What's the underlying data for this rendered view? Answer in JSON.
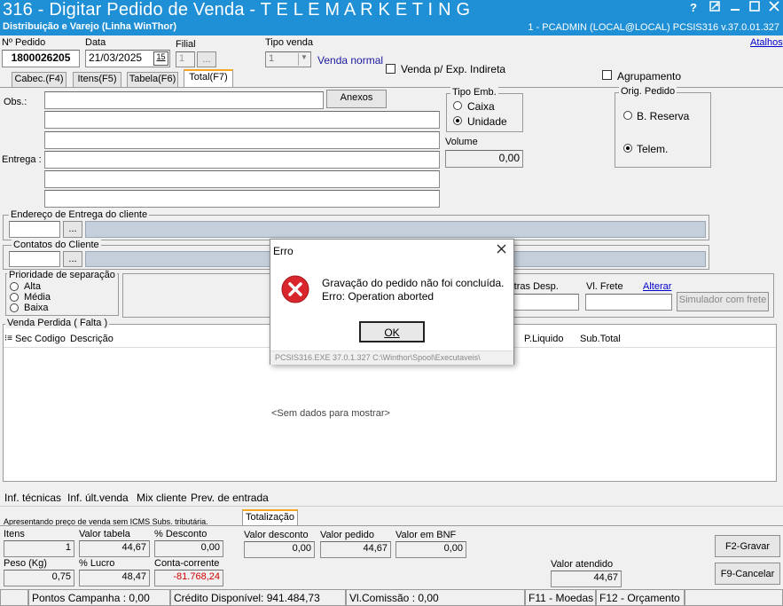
{
  "window": {
    "title": "316 - Digitar Pedido de Venda - T E L E M A R K E T I N G",
    "subtitle": "Distribuição e Varejo (Linha WinThor)",
    "session": "1 - PCADMIN (LOCAL@LOCAL)   PCSIS316  v.37.0.01.327",
    "help_glyph": "?",
    "atalhos": "Atalhos"
  },
  "header": {
    "pedido_label": "Nº Pedido",
    "pedido_value": "1800026205",
    "data_label": "Data",
    "data_value": "21/03/2025",
    "calendar_glyph": "15",
    "filial_label": "Filial",
    "filial_value": "1",
    "filial_btn": "...",
    "tipo_venda_label": "Tipo venda",
    "tipo_venda_value": "1",
    "tipo_venda_desc": "Venda normal",
    "exp_indireta_label": "Venda p/ Exp. Indireta",
    "agrupamento_label": "Agrupamento"
  },
  "tabs": [
    {
      "label": "Cabec.(F4)"
    },
    {
      "label": "Itens(F5)"
    },
    {
      "label": "Tabela(F6)"
    },
    {
      "label": "Total(F7)"
    }
  ],
  "total": {
    "obs_label": "Obs.:",
    "anexos_btn": "Anexos",
    "entrega_label": "Entrega :",
    "tipo_emb_title": "Tipo Emb.",
    "tipo_emb_options": [
      "Caixa",
      "Unidade"
    ],
    "volume_label": "Volume",
    "volume_value": "0,00",
    "orig_pedido_title": "Orig. Pedido",
    "orig_pedido_options": [
      "B. Reserva",
      "Telem."
    ],
    "endereco_title": "Endereço de Entrega do cliente",
    "contatos_title": "Contatos do Cliente",
    "ellipsis": "...",
    "prioridade_title": "Prioridade de separação",
    "prioridade_options": [
      "Alta",
      "Média",
      "Baixa"
    ],
    "outras_desp_label": "Outras Desp.",
    "vl_frete_label": "Vl. Frete",
    "alterar_link": "Alterar",
    "simulador_btn": "Simulador com frete",
    "venda_perdida_title": "Venda Perdida ( Falta )",
    "grid_columns": [
      "Sec",
      "Codigo",
      "Descrição",
      "P.Liquido",
      "Sub.Total"
    ],
    "grid_empty": "<Sem dados para mostrar>"
  },
  "bottom_links": [
    "Inf. técnicas",
    "Inf. últ.venda",
    "Mix cliente",
    "Prev. de entrada"
  ],
  "totals": {
    "note": "Apresentando preço de venda sem ICMS Subs. tributária.",
    "tab_label": "Totalização",
    "itens_label": "Itens",
    "itens_value": "1",
    "valor_tabela_label": "Valor tabela",
    "valor_tabela_value": "44,67",
    "pct_desconto_label": "% Desconto",
    "pct_desconto_value": "0,00",
    "valor_desconto_label": "Valor desconto",
    "valor_desconto_value": "0,00",
    "valor_pedido_label": "Valor pedido",
    "valor_pedido_value": "44,67",
    "valor_bnf_label": "Valor em BNF",
    "valor_bnf_value": "0,00",
    "peso_label": "Peso (Kg)",
    "peso_value": "0,75",
    "pct_lucro_label": "% Lucro",
    "pct_lucro_value": "48,47",
    "conta_corrente_label": "Conta-corrente",
    "conta_corrente_value": "-81.768,24",
    "valor_atendido_label": "Valor atendido",
    "valor_atendido_value": "44,67",
    "gravar_btn": "F2-Gravar",
    "cancelar_btn": "F9-Cancelar"
  },
  "statusbar": {
    "pontos": "Pontos Campanha : 0,00",
    "credito": "Crédito Disponível: 941.484,73",
    "comissao": "Vl.Comissão : 0,00",
    "moedas": "F11 - Moedas",
    "orcamento": "F12 - Orçamento"
  },
  "dialog": {
    "title": "Erro",
    "line1": "Gravação do pedido não foi concluída.",
    "line2": "Erro: Operation aborted",
    "ok_btn": "OK",
    "footer": "PCSIS316.EXE 37.0.1.327 C:\\Winthor\\Spool\\Executaveis\\"
  },
  "colors": {
    "titlebar": "#1f8fd6",
    "error_icon": "#d9262c",
    "negative": "#d00000",
    "link": "#0000cc",
    "tab_accent": "#f5a623"
  }
}
